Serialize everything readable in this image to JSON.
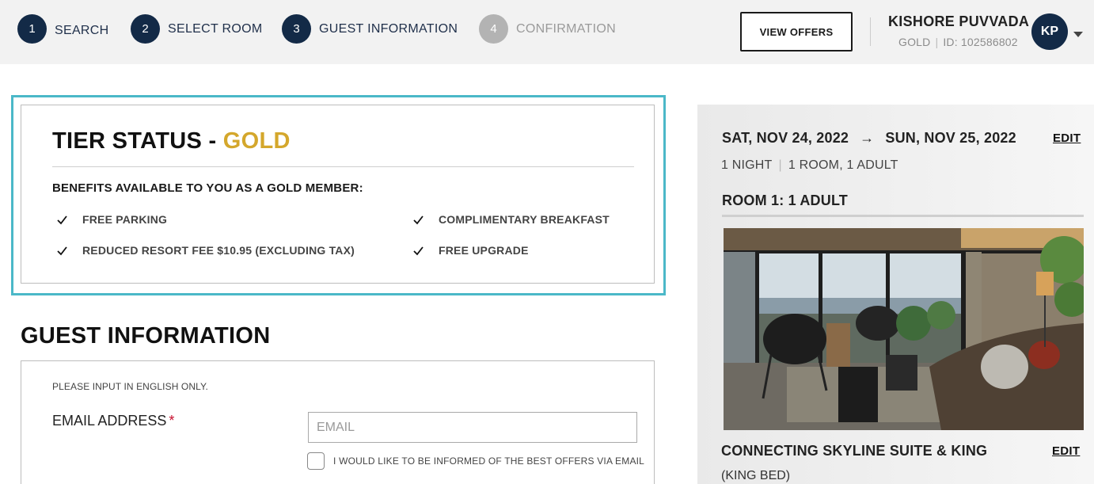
{
  "steps": [
    {
      "number": "1",
      "label": "SEARCH"
    },
    {
      "number": "2",
      "label": "SELECT ROOM"
    },
    {
      "number": "3",
      "label": "GUEST INFORMATION"
    },
    {
      "number": "4",
      "label": "CONFIRMATION"
    }
  ],
  "header": {
    "view_offers": "VIEW OFFERS",
    "user_name": "KISHORE PUVVADA",
    "tier": "GOLD",
    "separator": "|",
    "member_id": "ID: 102586802",
    "avatar_initials": "KP"
  },
  "tier_card": {
    "title_prefix": "TIER STATUS - ",
    "tier_name": "GOLD",
    "benefits_heading": "BENEFITS AVAILABLE TO YOU AS A GOLD MEMBER:",
    "benefits": [
      "FREE PARKING",
      "COMPLIMENTARY BREAKFAST",
      "REDUCED RESORT FEE $10.95 (EXCLUDING TAX)",
      "FREE UPGRADE"
    ]
  },
  "guest_info": {
    "heading": "GUEST INFORMATION",
    "note": "PLEASE INPUT IN ENGLISH ONLY.",
    "email_label": "EMAIL ADDRESS",
    "required_mark": "*",
    "email_value": "",
    "email_placeholder": "EMAIL",
    "optin_label": "I WOULD LIKE TO BE INFORMED OF THE BEST OFFERS VIA EMAIL"
  },
  "summary": {
    "check_in": "SAT, NOV 24, 2022",
    "arrow": "→",
    "check_out": "SUN, NOV 25, 2022",
    "edit_dates": "EDIT",
    "nights": "1 NIGHT",
    "separator": "|",
    "rooms_guests": "1 ROOM, 1 ADULT",
    "room_heading": "ROOM 1: 1 ADULT",
    "room_name": "CONNECTING SKYLINE SUITE & KING",
    "bed_type": "(KING BED)",
    "edit_room": "EDIT"
  },
  "colors": {
    "navy": "#132a47",
    "gold": "#d4a72c",
    "teal_outline": "#4bb8c8",
    "inactive_step": "#b3b3b3",
    "required": "#c8102e"
  }
}
